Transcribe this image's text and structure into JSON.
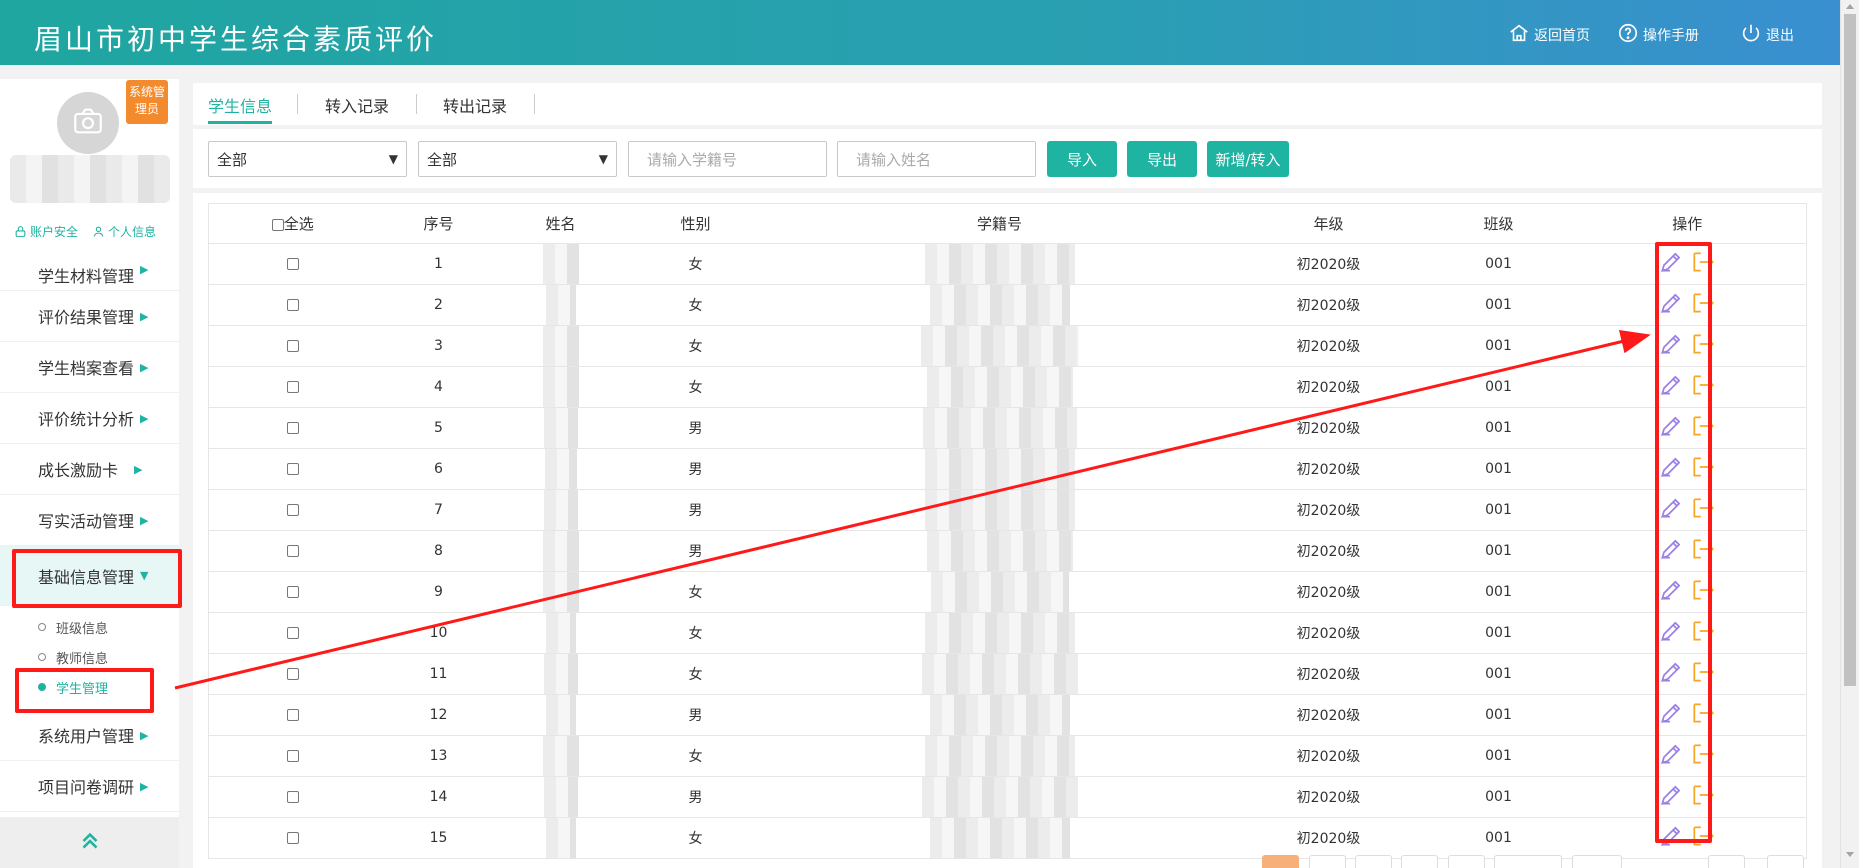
{
  "header": {
    "title": "眉山市初中学生综合素质评价",
    "home_label": "返回首页",
    "manual_label": "操作手册",
    "logout_label": "退出"
  },
  "sidebar": {
    "role_badge": "系统管理员",
    "account_security": "账户安全",
    "personal_info": "个人信息",
    "menu": [
      {
        "label": "学生材料管理"
      },
      {
        "label": "评价结果管理"
      },
      {
        "label": "学生档案查看"
      },
      {
        "label": "评价统计分析"
      },
      {
        "label": "成长激励卡"
      },
      {
        "label": "写实活动管理"
      },
      {
        "label": "基础信息管理"
      }
    ],
    "submenu": [
      {
        "label": "班级信息"
      },
      {
        "label": "教师信息"
      },
      {
        "label": "学生管理"
      }
    ],
    "menu_after": [
      {
        "label": "系统用户管理"
      },
      {
        "label": "项目问卷调研"
      }
    ]
  },
  "tabs": [
    {
      "label": "学生信息"
    },
    {
      "label": "转入记录"
    },
    {
      "label": "转出记录"
    }
  ],
  "filters": {
    "select1": "全部",
    "select2": "全部",
    "student_id_placeholder": "请输入学籍号",
    "name_placeholder": "请输入姓名",
    "import_label": "导入",
    "export_label": "导出",
    "add_label": "新增/转入"
  },
  "table": {
    "headers": {
      "select_all": "全选",
      "index": "序号",
      "name": "姓名",
      "gender": "性别",
      "student_id": "学籍号",
      "grade": "年级",
      "class": "班级",
      "actions": "操作"
    },
    "rows": [
      {
        "index": "1",
        "gender": "女",
        "grade": "初2020级",
        "class": "001"
      },
      {
        "index": "2",
        "gender": "女",
        "grade": "初2020级",
        "class": "001"
      },
      {
        "index": "3",
        "gender": "女",
        "grade": "初2020级",
        "class": "001"
      },
      {
        "index": "4",
        "gender": "女",
        "grade": "初2020级",
        "class": "001"
      },
      {
        "index": "5",
        "gender": "男",
        "grade": "初2020级",
        "class": "001"
      },
      {
        "index": "6",
        "gender": "男",
        "grade": "初2020级",
        "class": "001"
      },
      {
        "index": "7",
        "gender": "男",
        "grade": "初2020级",
        "class": "001"
      },
      {
        "index": "8",
        "gender": "男",
        "grade": "初2020级",
        "class": "001"
      },
      {
        "index": "9",
        "gender": "女",
        "grade": "初2020级",
        "class": "001"
      },
      {
        "index": "10",
        "gender": "女",
        "grade": "初2020级",
        "class": "001"
      },
      {
        "index": "11",
        "gender": "女",
        "grade": "初2020级",
        "class": "001"
      },
      {
        "index": "12",
        "gender": "男",
        "grade": "初2020级",
        "class": "001"
      },
      {
        "index": "13",
        "gender": "女",
        "grade": "初2020级",
        "class": "001"
      },
      {
        "index": "14",
        "gender": "男",
        "grade": "初2020级",
        "class": "001"
      },
      {
        "index": "15",
        "gender": "女",
        "grade": "初2020级",
        "class": "001"
      }
    ]
  },
  "colors": {
    "accent": "#1fb3a1",
    "badge": "#f48a2e",
    "annotation": "#ff1a1a",
    "edit_icon": "#9b7fe6",
    "transfer_icon": "#f5a623"
  },
  "icons": [
    "home-icon",
    "help-icon",
    "power-icon",
    "camera-icon",
    "lock-icon",
    "user-icon",
    "edit-icon",
    "transfer-out-icon",
    "double-chevron-up-icon"
  ]
}
